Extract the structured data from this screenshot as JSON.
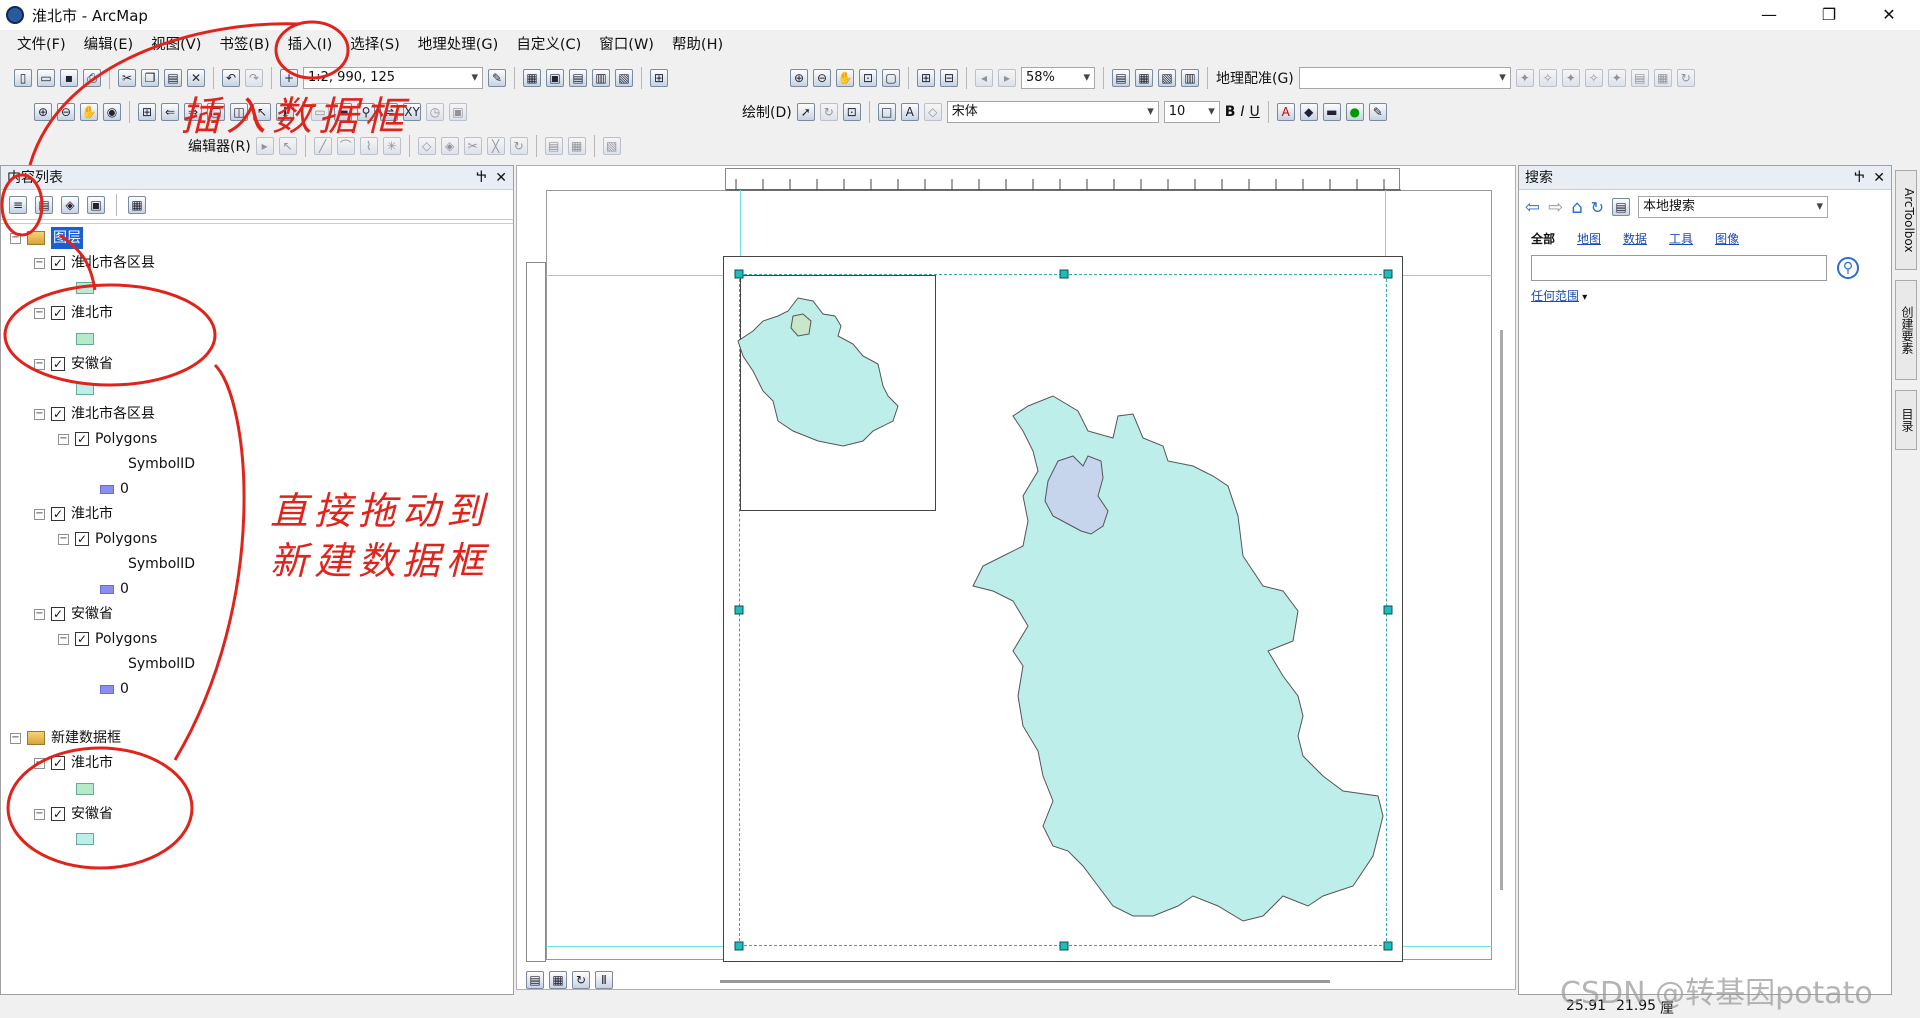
{
  "window": {
    "title": "淮北市 - ArcMap",
    "minimize": "—",
    "restore": "❐",
    "close": "✕"
  },
  "menu": [
    "文件(F)",
    "编辑(E)",
    "视图(V)",
    "书签(B)",
    "插入(I)",
    "选择(S)",
    "地理处理(G)",
    "自定义(C)",
    "窗口(W)",
    "帮助(H)"
  ],
  "toolbar": {
    "scale": "1:2, 990, 125",
    "zoom": "58%",
    "georef": "地理配准(G)",
    "draw": "绘制(D)",
    "font": "宋体",
    "font_size": "10",
    "bold": "B",
    "italic": "I",
    "underline": "U",
    "editor": "编辑器(R)"
  },
  "toc": {
    "title": "内容列表",
    "close": "✕",
    "pin": "Ⴕ",
    "items": [
      {
        "label": "图层"
      },
      {
        "label": "淮北市各区县"
      },
      {
        "label": "淮北市"
      },
      {
        "label": "安徽省"
      },
      {
        "label": "淮北市各区县"
      },
      {
        "label": "Polygons"
      },
      {
        "label": "SymbolID"
      },
      {
        "label": "0"
      },
      {
        "label": "淮北市"
      },
      {
        "label": "Polygons"
      },
      {
        "label": "SymbolID"
      },
      {
        "label": "0"
      },
      {
        "label": "安徽省"
      },
      {
        "label": "Polygons"
      },
      {
        "label": "SymbolID"
      },
      {
        "label": "0"
      },
      {
        "label": "新建数据框"
      },
      {
        "label": "淮北市"
      },
      {
        "label": "安徽省"
      }
    ]
  },
  "search": {
    "title": "搜索",
    "mode": "本地搜索",
    "tabs": [
      "全部",
      "地图",
      "数据",
      "工具",
      "图像"
    ],
    "scope": "任何范围",
    "placeholder": ""
  },
  "side_tabs": [
    "ArcToolbox",
    "创建要素",
    "目录"
  ],
  "annotations": {
    "insert": "插入数据框",
    "drag_line1": "直接拖动到",
    "drag_line2": "新建数据框"
  },
  "status": {
    "x": "25.91",
    "y": "21.95",
    "unit": "厘"
  },
  "watermark": "CSDN @转基因potato",
  "colors": {
    "province_fill": "#bdeeea",
    "city_fill": "#c6d4ec",
    "annot": "#e0241b"
  }
}
